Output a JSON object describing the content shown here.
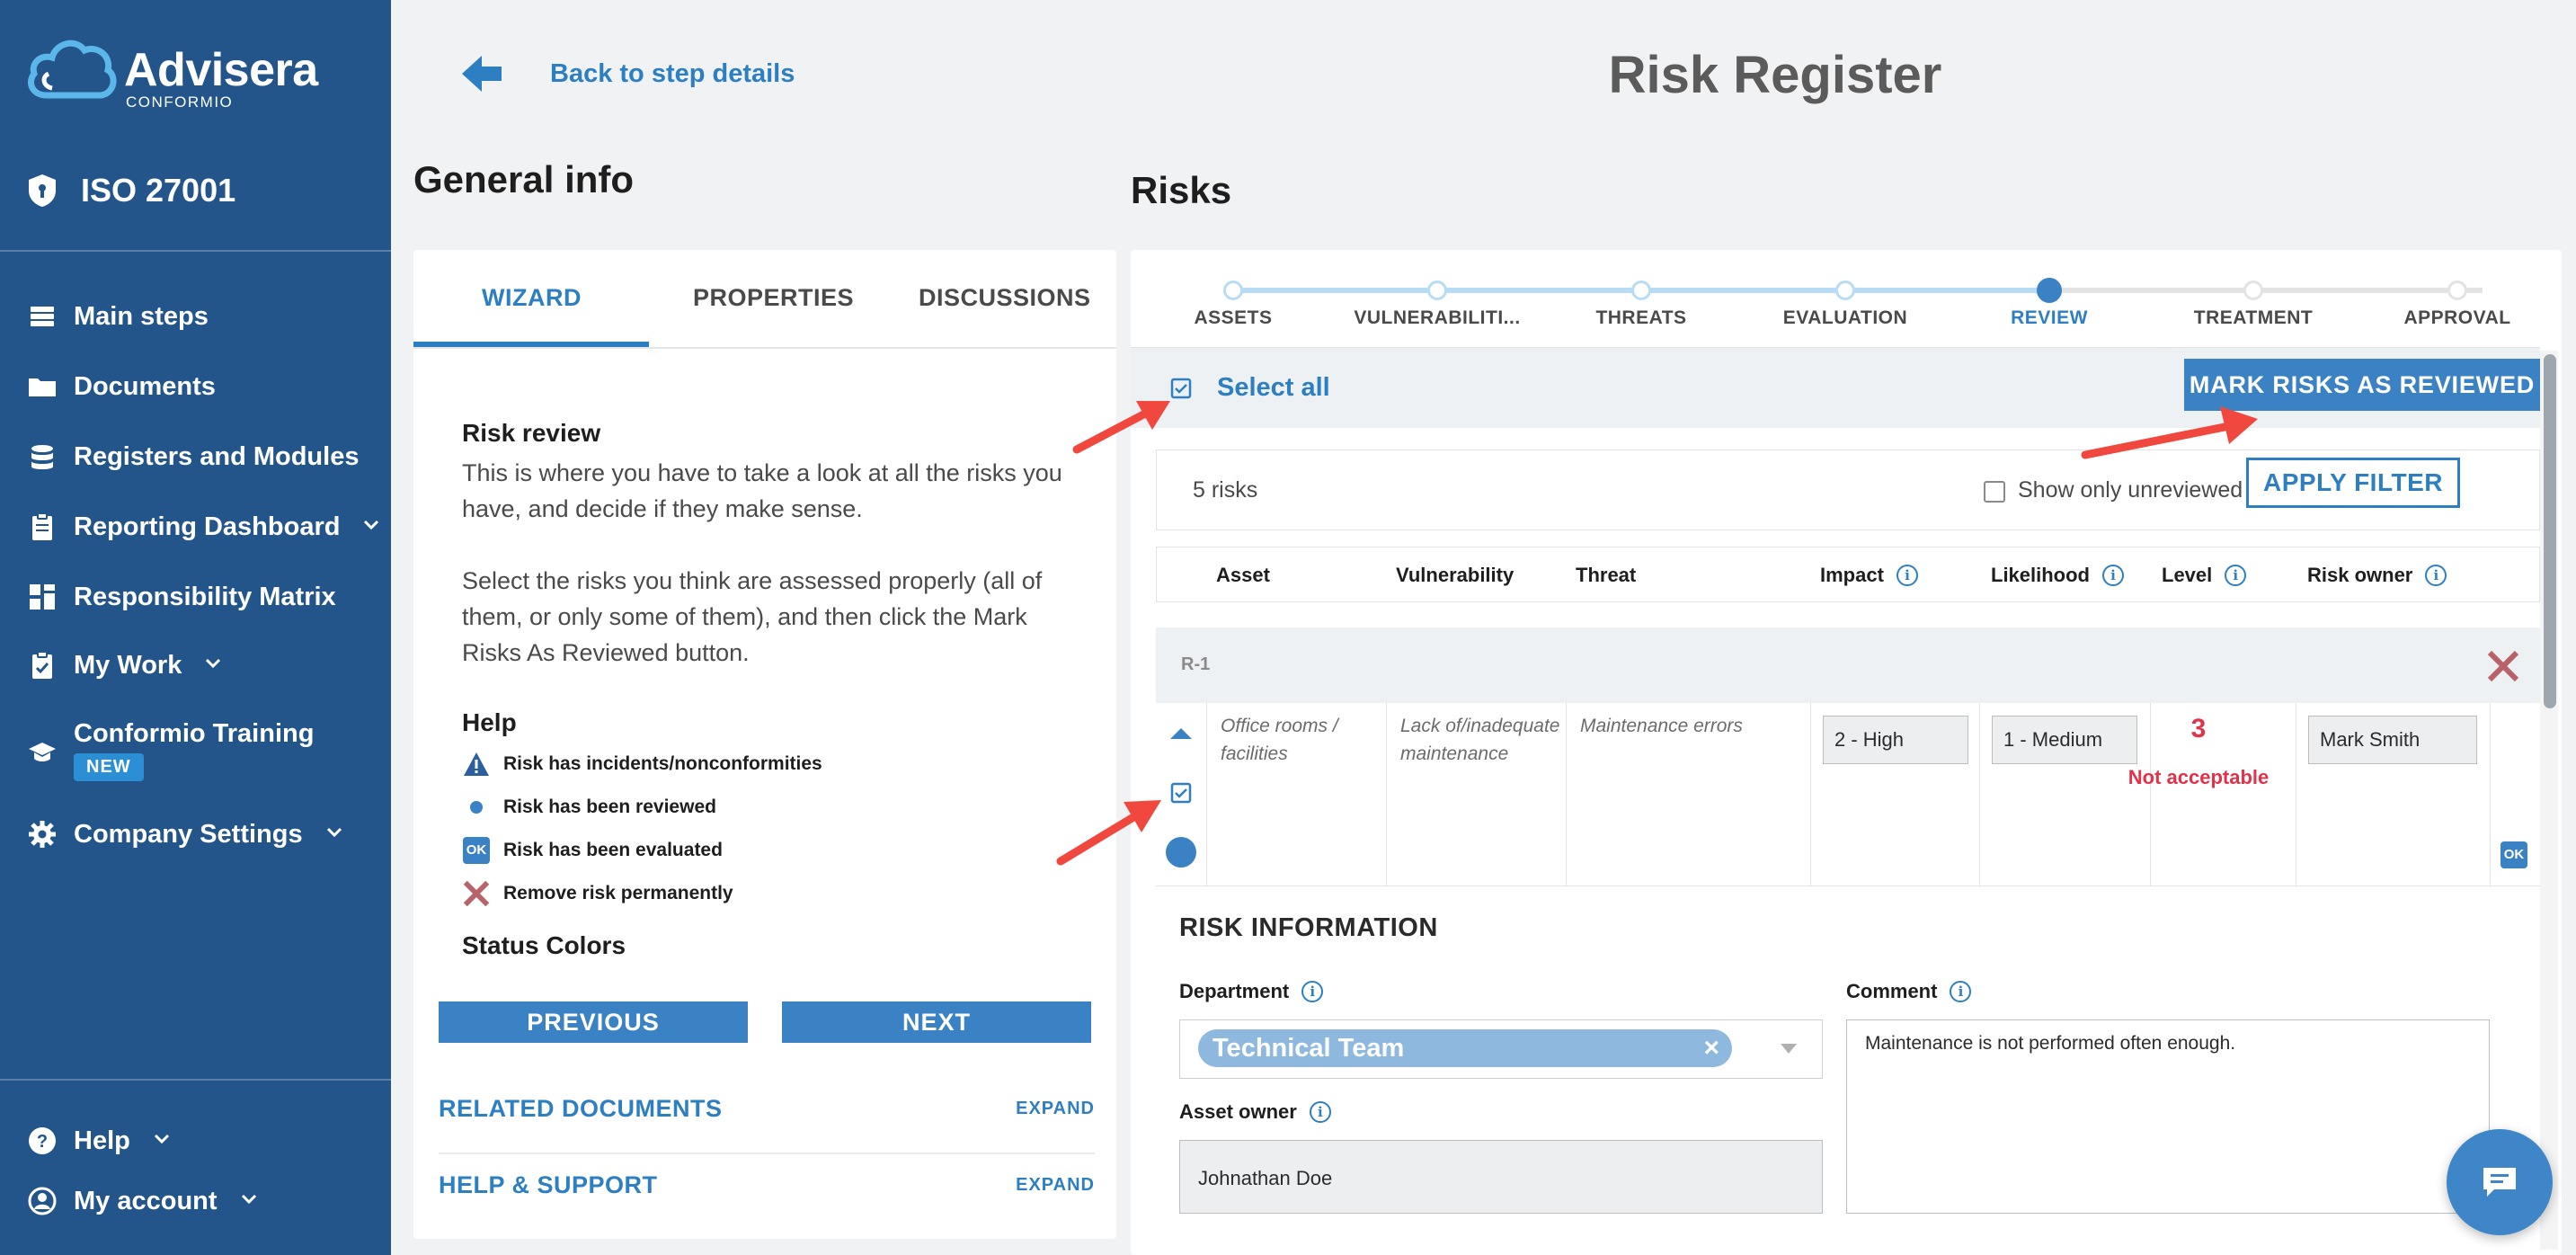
{
  "brand": {
    "name": "Advisera",
    "product": "CONFORMIO"
  },
  "sidebar": {
    "standard": "ISO 27001",
    "items": [
      {
        "label": "Main steps",
        "icon": "stack-icon"
      },
      {
        "label": "Documents",
        "icon": "folder-icon"
      },
      {
        "label": "Registers and Modules",
        "icon": "database-icon"
      },
      {
        "label": "Reporting Dashboard",
        "icon": "clipboard-icon"
      },
      {
        "label": "Responsibility Matrix",
        "icon": "grid-icon"
      },
      {
        "label": "My Work",
        "icon": "clipboard-check-icon"
      },
      {
        "label": "Conformio Training",
        "icon": "graduation-cap-icon"
      },
      {
        "label": "Company Settings",
        "icon": "gear-icon"
      }
    ],
    "training_badge": "NEW",
    "footer": [
      {
        "label": "Help",
        "icon": "question-icon"
      },
      {
        "label": "My account",
        "icon": "user-circle-icon"
      }
    ]
  },
  "header": {
    "back_label": "Back to step details",
    "title": "Risk Register"
  },
  "general_info": {
    "heading": "General info",
    "tabs": [
      "WIZARD",
      "PROPERTIES",
      "DISCUSSIONS"
    ],
    "wizard": {
      "title": "Risk review",
      "p1": "This is where you have to take a look at all the risks you have, and decide if they make sense.",
      "p2": "Select the risks you think are assessed properly (all of them, or only some of them), and then click the Mark Risks As Reviewed button.",
      "help_title": "Help",
      "help_items": [
        "Risk has incidents/nonconformities",
        "Risk has been reviewed",
        "Risk has been evaluated",
        "Remove risk permanently"
      ],
      "ok_label": "OK",
      "status_colors": "Status Colors"
    },
    "prev_label": "PREVIOUS",
    "next_label": "NEXT",
    "sections": [
      {
        "title": "RELATED DOCUMENTS",
        "action": "EXPAND"
      },
      {
        "title": "HELP & SUPPORT",
        "action": "EXPAND"
      }
    ]
  },
  "risks": {
    "heading": "Risks",
    "steps": [
      "ASSETS",
      "VULNERABILITI...",
      "THREATS",
      "EVALUATION",
      "REVIEW",
      "TREATMENT",
      "APPROVAL"
    ],
    "active_step": 4,
    "select_all_label": "Select all",
    "mark_label": "MARK RISKS AS REVIEWED",
    "count": "5 risks",
    "unreviewed_label": "Show only unreviewed risks",
    "apply_label": "APPLY FILTER",
    "columns": [
      "Asset",
      "Vulnerability",
      "Threat",
      "Impact",
      "Likelihood",
      "Level",
      "Risk owner"
    ],
    "row": {
      "id": "R-1",
      "asset": "Office rooms / facilities",
      "vulnerability": "Lack of/inadequate maintenance",
      "threat": "Maintenance errors",
      "impact": "2 - High",
      "likelihood": "1 - Medium",
      "level": "3",
      "level_text": "Not acceptable",
      "owner": "Mark Smith",
      "ok_label": "OK"
    },
    "info": {
      "title": "RISK INFORMATION",
      "department_label": "Department",
      "department_value": "Technical Team",
      "owner_label": "Asset owner",
      "owner_value": "Johnathan Doe",
      "comment_label": "Comment",
      "comment_value": "Maintenance is not performed often enough."
    }
  },
  "colors": {
    "sidebar": "#24558a",
    "accent": "#2d7fc1",
    "button": "#3b82c4",
    "danger": "#e0334a",
    "arrow": "#f0483e"
  }
}
